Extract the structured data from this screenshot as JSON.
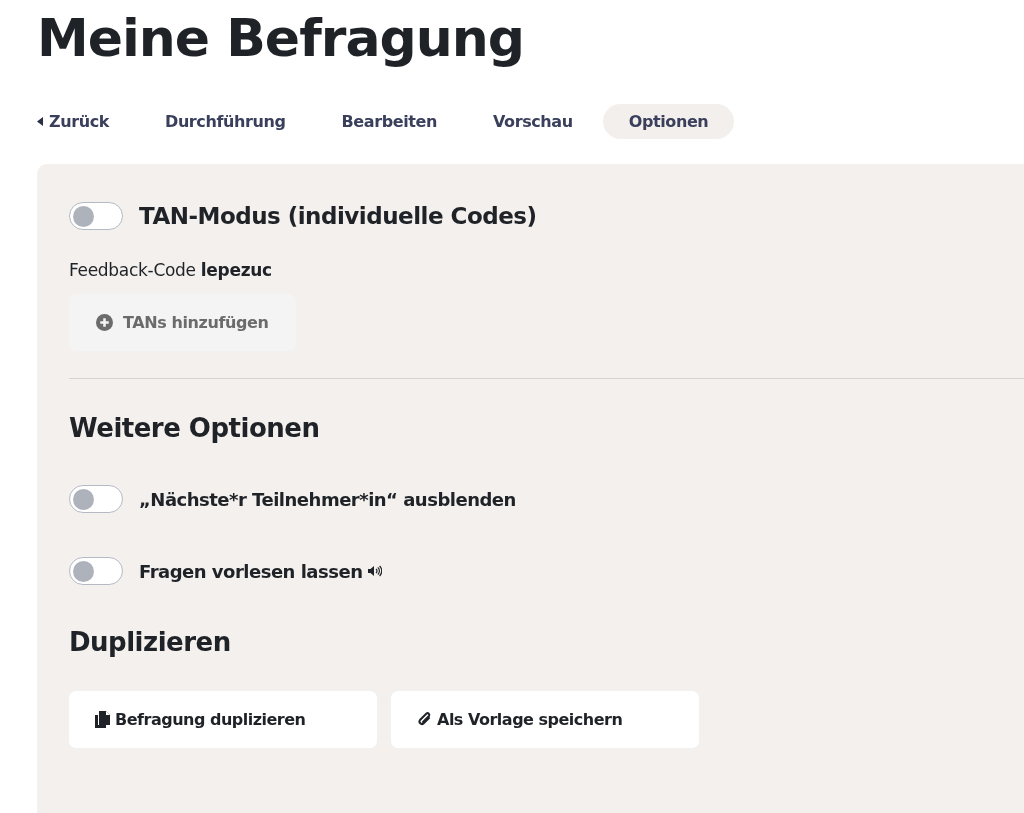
{
  "title": "Meine Befragung",
  "nav": [
    {
      "label": "Zurück",
      "kind": "back",
      "selected": false
    },
    {
      "label": "Durchführung",
      "kind": "tab",
      "selected": false
    },
    {
      "label": "Bearbeiten",
      "kind": "tab",
      "selected": false
    },
    {
      "label": "Vorschau",
      "kind": "tab",
      "selected": false
    },
    {
      "label": "Optionen",
      "kind": "tab",
      "selected": true
    }
  ],
  "tan_mode": {
    "label": "TAN-Modus (individuelle Codes)",
    "on": false
  },
  "feedback_code": "Feedback-Code **lepezuc**",
  "add_tans_button": "TANs hinzufügen",
  "more_options": {
    "heading": "Weitere Optionen",
    "toggles": [
      {
        "label": "„Nächste*r Teilnehmer*in“ ausblenden",
        "on": false,
        "kind": "plain"
      },
      {
        "label": "Fragen vorlesen lassen",
        "on": false,
        "kind": "audio"
      }
    ]
  },
  "duplicate": {
    "heading": "Duplizieren",
    "buttons": [
      {
        "label": "Befragung duplizieren",
        "kind": "copy"
      },
      {
        "label": "Als Vorlage speichern",
        "kind": "attach"
      }
    ]
  }
}
